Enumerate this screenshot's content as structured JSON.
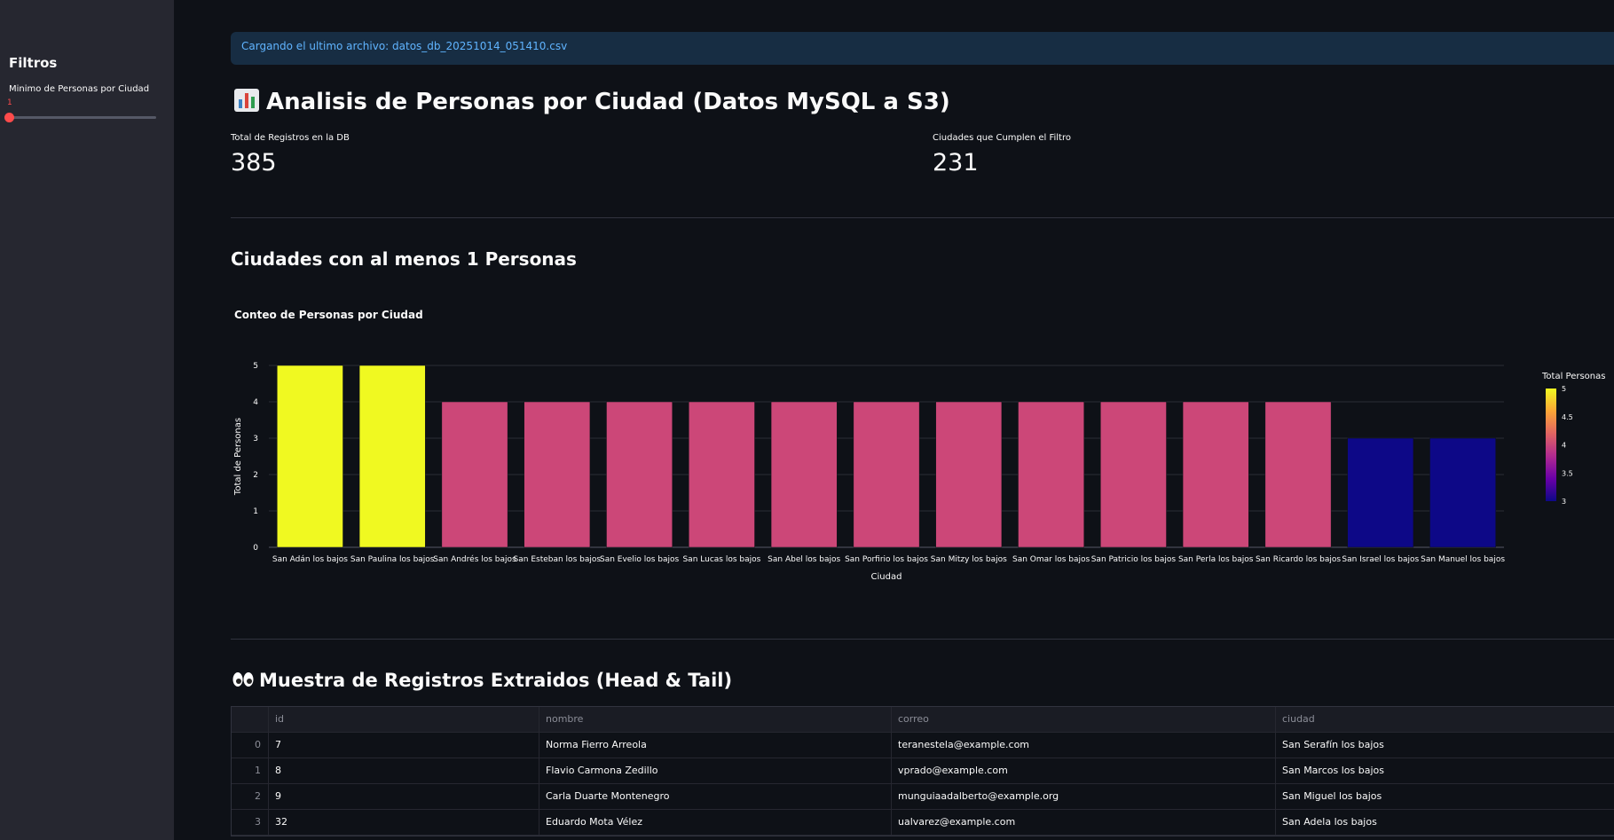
{
  "sidebar": {
    "title": "Filtros",
    "slider": {
      "label": "Minimo de Personas por Ciudad",
      "value": "1",
      "min": 1,
      "max": 5,
      "level": 0
    }
  },
  "alert": {
    "text": "Cargando el ultimo archivo: datos_db_20251014_051410.csv"
  },
  "page_title": "Analisis de Personas por Ciudad (Datos MySQL a S3)",
  "page_title_icon": "bar-chart-icon",
  "metrics": [
    {
      "label": "Total de Registros en la DB",
      "value": "385"
    },
    {
      "label": "Ciudades que Cumplen el Filtro",
      "value": "231"
    }
  ],
  "chart_section_title": "Ciudades con al menos 1 Personas",
  "table_section_title": "Muestra de Registros Extraidos (Head & Tail)",
  "table_section_icon": "eyes-icon",
  "chart_data": {
    "type": "bar",
    "title": "Conteo de Personas por Ciudad",
    "xlabel": "Ciudad",
    "ylabel": "Total de Personas",
    "categories": [
      "San Adán los bajos",
      "San Paulina los bajos",
      "San Andrés los bajos",
      "San Esteban los bajos",
      "San Evelio los bajos",
      "San Lucas los bajos",
      "San Abel los bajos",
      "San Porfirio los bajos",
      "San Mitzy los bajos",
      "San Omar los bajos",
      "San Patricio los bajos",
      "San Perla los bajos",
      "San Ricardo los bajos",
      "San Israel los bajos",
      "San Manuel los bajos"
    ],
    "values": [
      5,
      5,
      4,
      4,
      4,
      4,
      4,
      4,
      4,
      4,
      4,
      4,
      4,
      3,
      3
    ],
    "ylim": [
      0,
      5
    ],
    "yticks": [
      "0",
      "1",
      "2",
      "3",
      "4",
      "5"
    ],
    "grid": true,
    "colorbar": {
      "title": "Total Personas",
      "ticks": [
        "5",
        "4.5",
        "4",
        "3.5",
        "3"
      ],
      "min": 3,
      "max": 5,
      "colors": {
        "5": "#f0f921",
        "4": "#cc4778",
        "3": "#0d0887"
      },
      "gradient": [
        "#f0f921",
        "#fca636",
        "#e16462",
        "#b12a90",
        "#6a00a8",
        "#0d0887"
      ]
    }
  },
  "table": {
    "columns": [
      "id",
      "nombre",
      "correo",
      "ciudad"
    ],
    "rows": [
      {
        "index": "0",
        "id": "7",
        "nombre": "Norma Fierro Arreola",
        "correo": "teranestela@example.com",
        "ciudad": "San Serafín los bajos"
      },
      {
        "index": "1",
        "id": "8",
        "nombre": "Flavio Carmona Zedillo",
        "correo": "vprado@example.com",
        "ciudad": "San Marcos los bajos"
      },
      {
        "index": "2",
        "id": "9",
        "nombre": "Carla Duarte Montenegro",
        "correo": "munguiaadalberto@example.org",
        "ciudad": "San Miguel los bajos"
      },
      {
        "index": "3",
        "id": "32",
        "nombre": "Eduardo Mota Vélez",
        "correo": "ualvarez@example.com",
        "ciudad": "San Adela los bajos"
      }
    ]
  },
  "colors": {
    "background": "#0e1117",
    "sidebar": "#262730",
    "accent": "#ff4b4b",
    "alert_bg": "#172d43",
    "alert_text": "#60b4ff"
  }
}
